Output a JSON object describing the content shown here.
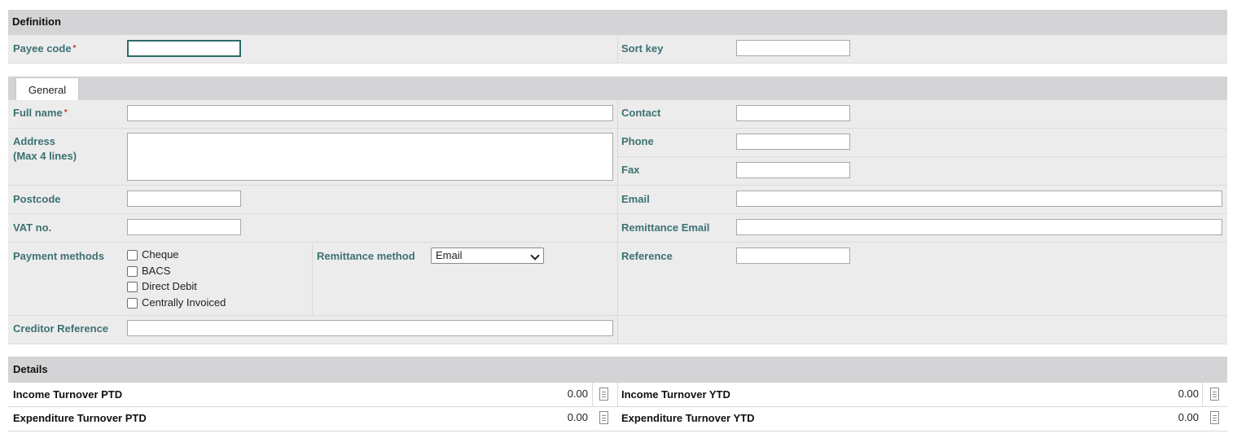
{
  "definition": {
    "title": "Definition",
    "payee_code_label": "Payee code",
    "payee_code_value": "",
    "required_marker": "*",
    "sort_key_label": "Sort key",
    "sort_key_value": ""
  },
  "general": {
    "tab_label": "General",
    "full_name_label": "Full name",
    "full_name_value": "",
    "contact_label": "Contact",
    "contact_value": "",
    "address_label_line1": "Address",
    "address_label_line2": "(Max 4 lines)",
    "address_value": "",
    "phone_label": "Phone",
    "phone_value": "",
    "fax_label": "Fax",
    "fax_value": "",
    "postcode_label": "Postcode",
    "postcode_value": "",
    "email_label": "Email",
    "email_value": "",
    "vat_label": "VAT no.",
    "vat_value": "",
    "remittance_email_label": "Remittance Email",
    "remittance_email_value": "",
    "payment_methods_label": "Payment methods",
    "payment_methods": [
      {
        "label": "Cheque",
        "checked": false
      },
      {
        "label": "BACS",
        "checked": false
      },
      {
        "label": "Direct Debit",
        "checked": false
      },
      {
        "label": "Centrally Invoiced",
        "checked": false
      }
    ],
    "remittance_method_label": "Remittance method",
    "remittance_method_value": "Email",
    "reference_label": "Reference",
    "reference_value": "",
    "creditor_reference_label": "Creditor Reference",
    "creditor_reference_value": ""
  },
  "details": {
    "title": "Details",
    "income_ptd_label": "Income Turnover PTD",
    "income_ptd_value": "0.00",
    "income_ytd_label": "Income Turnover YTD",
    "income_ytd_value": "0.00",
    "expenditure_ptd_label": "Expenditure Turnover PTD",
    "expenditure_ptd_value": "0.00",
    "expenditure_ytd_label": "Expenditure Turnover YTD",
    "expenditure_ytd_value": "0.00"
  }
}
